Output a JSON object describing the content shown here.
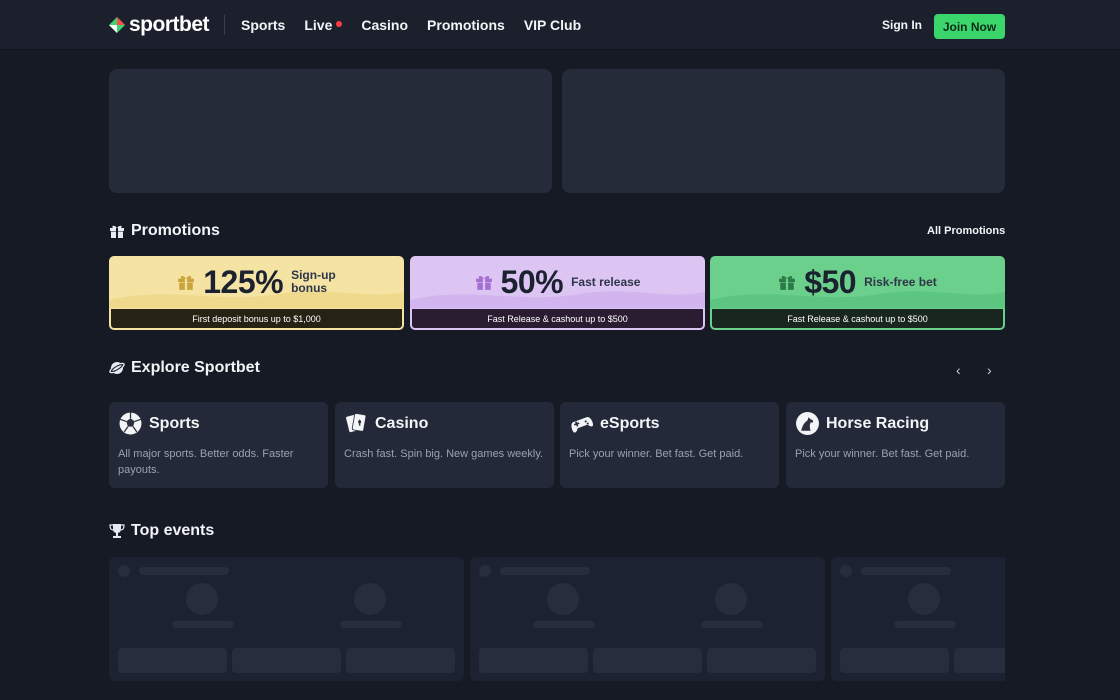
{
  "header": {
    "logo_text": "sportbet",
    "nav": [
      {
        "label": "Sports"
      },
      {
        "label": "Live",
        "badge": "live-dot"
      },
      {
        "label": "Casino"
      },
      {
        "label": "Promotions"
      },
      {
        "label": "VIP Club"
      }
    ],
    "sign_in": "Sign In",
    "join_now": "Join Now"
  },
  "promotions": {
    "title": "Promotions",
    "all_link": "All Promotions",
    "cards": [
      {
        "big": "125%",
        "small_line1": "Sign-up",
        "small_line2": "bonus",
        "footer": "First deposit bonus up to $1,000",
        "color": "#f4e3a2"
      },
      {
        "big": "50%",
        "small_line1": "Fast release",
        "small_line2": "",
        "footer": "Fast Release & cashout up to $500",
        "color": "#dcc5f2"
      },
      {
        "big": "$50",
        "small_line1": "Risk-free bet",
        "small_line2": "",
        "footer": "Fast Release & cashout up to $500",
        "color": "#6bd08c"
      }
    ]
  },
  "explore": {
    "title": "Explore Sportbet",
    "prev_icon": "chevron-left-icon",
    "next_icon": "chevron-right-icon",
    "cards": [
      {
        "name": "Sports",
        "icon": "soccer-ball-icon",
        "desc": "All major sports. Better odds. Faster payouts."
      },
      {
        "name": "Casino",
        "icon": "playing-cards-icon",
        "desc": "Crash fast. Spin big. New games weekly."
      },
      {
        "name": "eSports",
        "icon": "gamepad-icon",
        "desc": "Pick your winner. Bet fast. Get paid."
      },
      {
        "name": "Horse Racing",
        "icon": "horse-icon",
        "desc": "Pick your winner. Bet fast. Get paid."
      }
    ]
  },
  "top_events": {
    "title": "Top events"
  },
  "colors": {
    "background": "#151a25",
    "header": "#1b202c",
    "accent_green": "#3bd66b",
    "live_red": "#ff3b3b",
    "card": "#232938"
  }
}
